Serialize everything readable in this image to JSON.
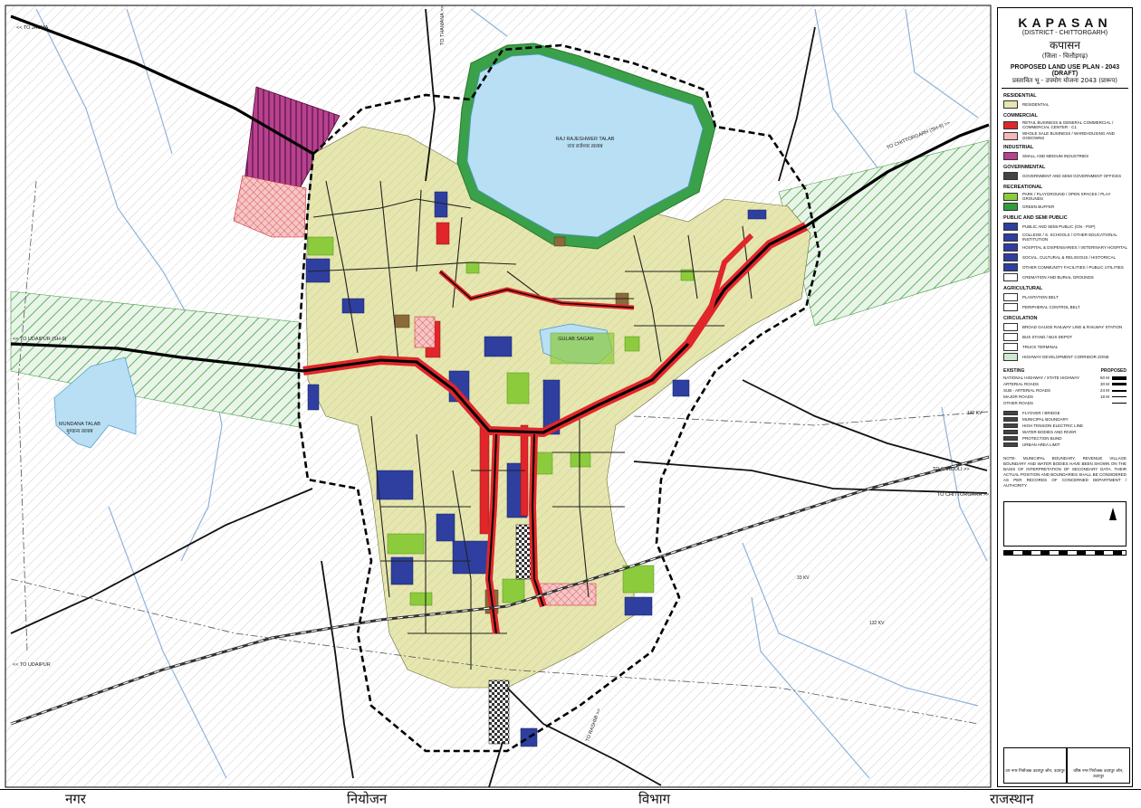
{
  "header": {
    "title": "KAPASAN",
    "district": "(DISTRICT - CHITTORGARH)",
    "title_hindi": "कपासन",
    "district_hindi": "(जिला - चित्तौड़गढ़)",
    "plan_title": "PROPOSED LAND USE PLAN - 2043 (DRAFT)",
    "plan_title_hindi": "प्रस्तावित भू - उपयोग योजना 2043 (प्रारूप)"
  },
  "map_labels": {
    "lake_main": "RAJ RAJESHWER TALAB",
    "lake_main_hindi": "राज राजेश्वर तालाब",
    "lake_small": "GULAB SAGAR",
    "lake_west": "MUNDANA TALAB",
    "lake_west_hindi": "मुण्डाना तालाब",
    "to_jasma": "<< TO JASMA",
    "to_thamana": "TO THAMANA >>",
    "to_udaipur_w": "<< TO UDAIPUR (SH-9)",
    "to_chittorgarh_ne": "TO CHITTORGARH (SH-9) >>",
    "to_fandoli": "TO FANDOLI >>",
    "to_chittorgarh_e": "TO CHITTORGARH >>",
    "to_udaipur_sw": "<< TO UDAIPUR",
    "to_rashmi": "TO RASHMI >>",
    "ekv_1": "132 KV",
    "ekv_2": "132 KV",
    "ekv_3": "33 KV"
  },
  "legend": {
    "sections": [
      {
        "heading": "RESIDENTIAL",
        "items": [
          {
            "label": "RESIDENTIAL",
            "color": "#e6e6b0"
          }
        ]
      },
      {
        "heading": "COMMERCIAL",
        "items": [
          {
            "label": "RETAIL BUSINESS & GENERAL COMMERCIAL / COMMERCIAL CENTER - C1",
            "color": "#e0262a"
          },
          {
            "label": "WHOLE SALE BUSINESS / WAREHOUSING AND GODOWNS",
            "color": "#f4b8b8"
          }
        ]
      },
      {
        "heading": "INDUSTRIAL",
        "items": [
          {
            "label": "SMALL AND MEDIUM INDUSTRIES",
            "color": "#b8428e"
          }
        ]
      },
      {
        "heading": "GOVERNMENTAL",
        "items": [
          {
            "label": "GOVERNMENT AND SEMI GOVERNMENT OFFICES",
            "color": "#444444"
          }
        ]
      },
      {
        "heading": "RECREATIONAL",
        "items": [
          {
            "label": "PARK / PLAYGROUND / OPEN SPACES / PLAY GROUNDS",
            "color": "#8ccc3c"
          },
          {
            "label": "GREEN BUFFER",
            "color": "#2e9e3e"
          }
        ]
      },
      {
        "heading": "PUBLIC AND SEMI PUBLIC",
        "items": [
          {
            "label": "PUBLIC AND SEMI PUBLIC (GN - PSP)",
            "color": "#2e3fa0"
          },
          {
            "label": "COLLEGE / S. SCHOOLS / OTHER EDUCATIONAL INSTITUTION",
            "color": "#2e3fa0"
          },
          {
            "label": "HOSPITAL & DISPENSARIES / VETERINARY HOSPITAL",
            "color": "#2e3fa0"
          },
          {
            "label": "SOCIAL, CULTURAL & RELIGIOUS / HISTORICAL",
            "color": "#2e3fa0"
          },
          {
            "label": "OTHER COMMUNITY FACILITIES / PUBLIC UTILITIES",
            "color": "#2e3fa0"
          },
          {
            "label": "CREMATION AND BURIAL GROUNDS",
            "color": "#ffffff"
          }
        ]
      },
      {
        "heading": "AGRICULTURAL",
        "items": [
          {
            "label": "PLANTATION BELT",
            "color": "#ffffff"
          },
          {
            "label": "PERIPHERAL CONTROL BELT",
            "color": "#ffffff"
          }
        ]
      },
      {
        "heading": "CIRCULATION",
        "items": [
          {
            "label": "BROAD GAUGE RAILWAY LINE & RAILWAY STATION",
            "color": "#ffffff"
          },
          {
            "label": "BUS STAND / BUS DEPOT",
            "color": "#ffffff"
          },
          {
            "label": "TRUCK TERMINAL",
            "color": "#ffffff"
          },
          {
            "label": "HIGHWAY DEVELOPMENT CORRIDOR ZONE",
            "color": "#cfe8cf"
          }
        ]
      }
    ],
    "roads_heading_existing": "EXISTING",
    "roads_heading_proposed": "PROPOSED",
    "roads": [
      {
        "label": "NATIONAL HIGHWAY / STATE HIGHWAY",
        "width": "60 M"
      },
      {
        "label": "ARTERIAL ROADS",
        "width": "30 M"
      },
      {
        "label": "SUB - ARTERIAL ROADS",
        "width": "24 M"
      },
      {
        "label": "MAJOR ROADS",
        "width": "18 M"
      },
      {
        "label": "OTHER ROADS",
        "width": ""
      }
    ],
    "misc": [
      {
        "label": "FLYOVER / BRIDGE"
      },
      {
        "label": "MUNICIPAL BOUNDARY"
      },
      {
        "label": "HIGH TENSION ELECTRIC LINE"
      },
      {
        "label": "WATER BODIES AND RIVER"
      },
      {
        "label": "PROTECTION BUND"
      },
      {
        "label": "URBAN AREA LIMIT"
      }
    ],
    "note": "NOTE- MUNICIPAL BOUNDARY, REVENUE VILLAGE BOUNDARY AND WATER BODIES HAVE BEEN SHOWN ON THE BASIS OF INTERPRETATION OF SECONDARY DATA. THEIR ACTUAL POSITION AND BOUNDARIES SHALL BE CONSIDERED AS PER RECORDS OF CONCERNED DEPARTMENT / AUTHORITY.",
    "sign_left": "उप नगर नियोजक उदयपुर जोन, उदयपुर",
    "sign_right": "वरिष्ठ नगर नियोजक उदयपुर जोन, उदयपुर"
  },
  "footer": {
    "word1": "नगर",
    "word2": "नियोजन",
    "word3": "विभाग",
    "word4": "राजस्थान"
  },
  "colors": {
    "residential": "#e6e6b0",
    "commercial": "#e0262a",
    "industrial": "#b8428e",
    "park": "#8ccc3c",
    "green_buffer": "#2e9e3e",
    "public": "#2e3fa0",
    "water": "#b8dff4",
    "corridor": "#cfe8cf"
  }
}
